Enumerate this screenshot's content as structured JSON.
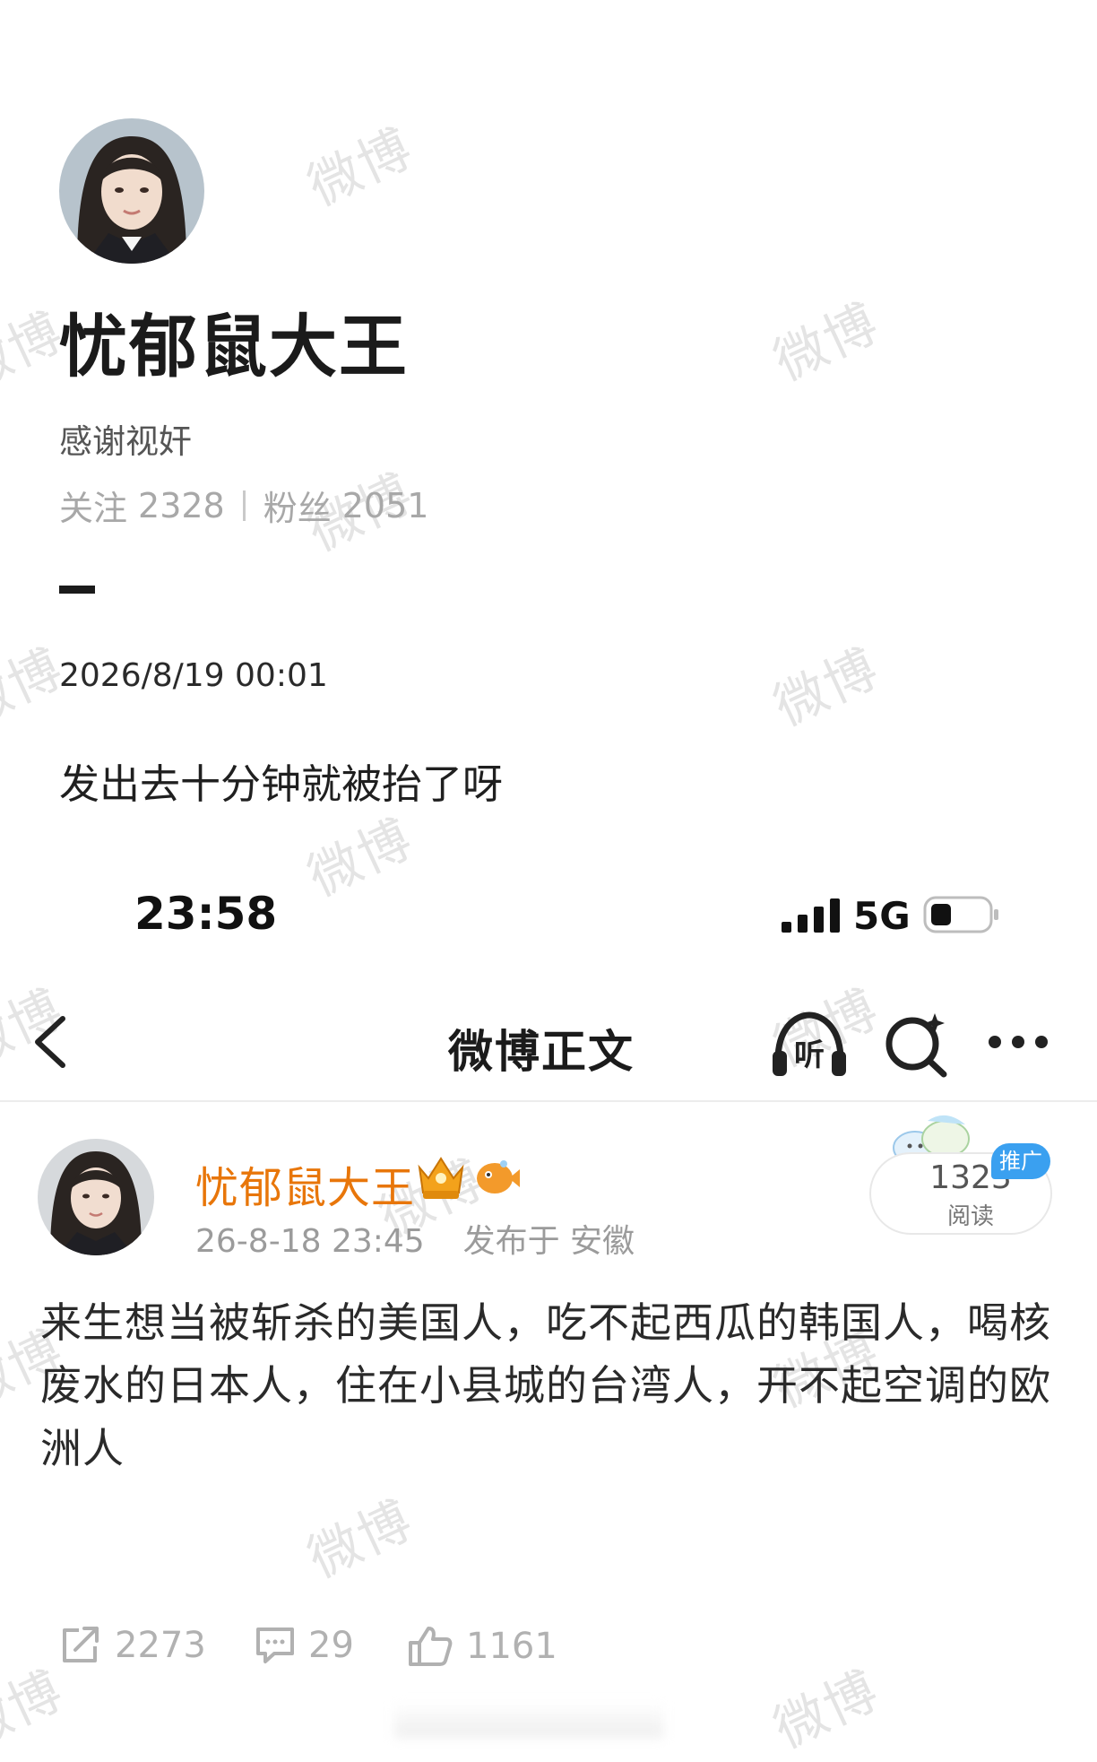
{
  "profile": {
    "name": "忧郁鼠大王",
    "bio": "感谢视奸",
    "following_label": "关注",
    "following_count": "2328",
    "followers_label": "粉丝",
    "followers_count": "2051"
  },
  "caption_post": {
    "date": "2026/8/19 00:01",
    "text": "发出去十分钟就被抬了呀"
  },
  "status_bar": {
    "time": "23:58",
    "network": "5G"
  },
  "nav": {
    "title": "微博正文"
  },
  "weibo_post": {
    "author": "忧郁鼠大王",
    "timestamp": "26-8-18 23:45",
    "location": "发布于 安徽",
    "read_count": "1323",
    "read_label": "阅读",
    "promo_label": "推广",
    "body": "来生想当被斩杀的美国人，吃不起西瓜的韩国人，喝核废水的日本人，住在小县城的台湾人，开不起空调的欧洲人",
    "reposts": "2273",
    "comments": "29",
    "likes": "1161"
  },
  "watermark": "微博",
  "colors": {
    "author_orange": "#e8760a",
    "stats_gray": "#a8a8a8",
    "promo_blue": "#3aa0f0"
  }
}
